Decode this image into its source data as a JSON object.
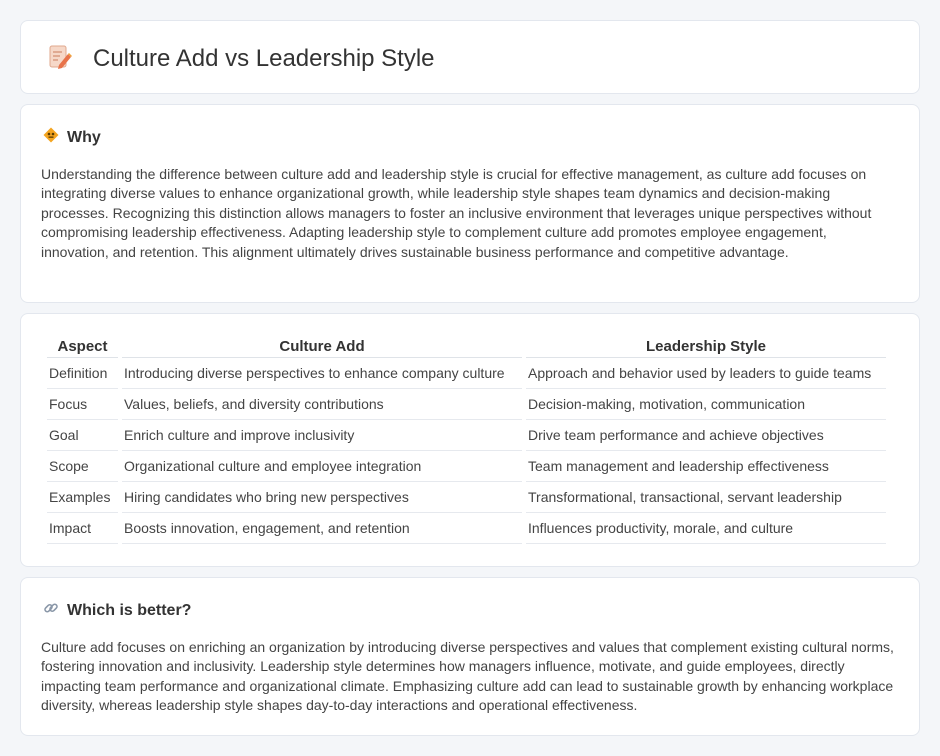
{
  "header": {
    "title": "Culture Add vs Leadership Style",
    "icon": "edit-document-icon"
  },
  "why": {
    "title": "Why",
    "icon": "diamond-sign-icon",
    "body": "Understanding the difference between culture add and leadership style is crucial for effective management, as culture add focuses on integrating diverse values to enhance organizational growth, while leadership style shapes team dynamics and decision-making processes. Recognizing this distinction allows managers to foster an inclusive environment that leverages unique perspectives without compromising leadership effectiveness. Adapting leadership style to complement culture add promotes employee engagement, innovation, and retention. This alignment ultimately drives sustainable business performance and competitive advantage."
  },
  "comparison": {
    "headers": [
      "Aspect",
      "Culture Add",
      "Leadership Style"
    ],
    "rows": [
      [
        "Definition",
        "Introducing diverse perspectives to enhance company culture",
        "Approach and behavior used by leaders to guide teams"
      ],
      [
        "Focus",
        "Values, beliefs, and diversity contributions",
        "Decision-making, motivation, communication"
      ],
      [
        "Goal",
        "Enrich culture and improve inclusivity",
        "Drive team performance and achieve objectives"
      ],
      [
        "Scope",
        "Organizational culture and employee integration",
        "Team management and leadership effectiveness"
      ],
      [
        "Examples",
        "Hiring candidates who bring new perspectives",
        "Transformational, transactional, servant leadership"
      ],
      [
        "Impact",
        "Boosts innovation, engagement, and retention",
        "Influences productivity, morale, and culture"
      ]
    ]
  },
  "better": {
    "title": "Which is better?",
    "icon": "link-icon",
    "body": "Culture add focuses on enriching an organization by introducing diverse perspectives and values that complement existing cultural norms, fostering innovation and inclusivity. Leadership style determines how managers influence, motivate, and guide employees, directly impacting team performance and organizational climate. Emphasizing culture add can lead to sustainable growth by enhancing workplace diversity, whereas leadership style shapes day-to-day interactions and operational effectiveness."
  }
}
